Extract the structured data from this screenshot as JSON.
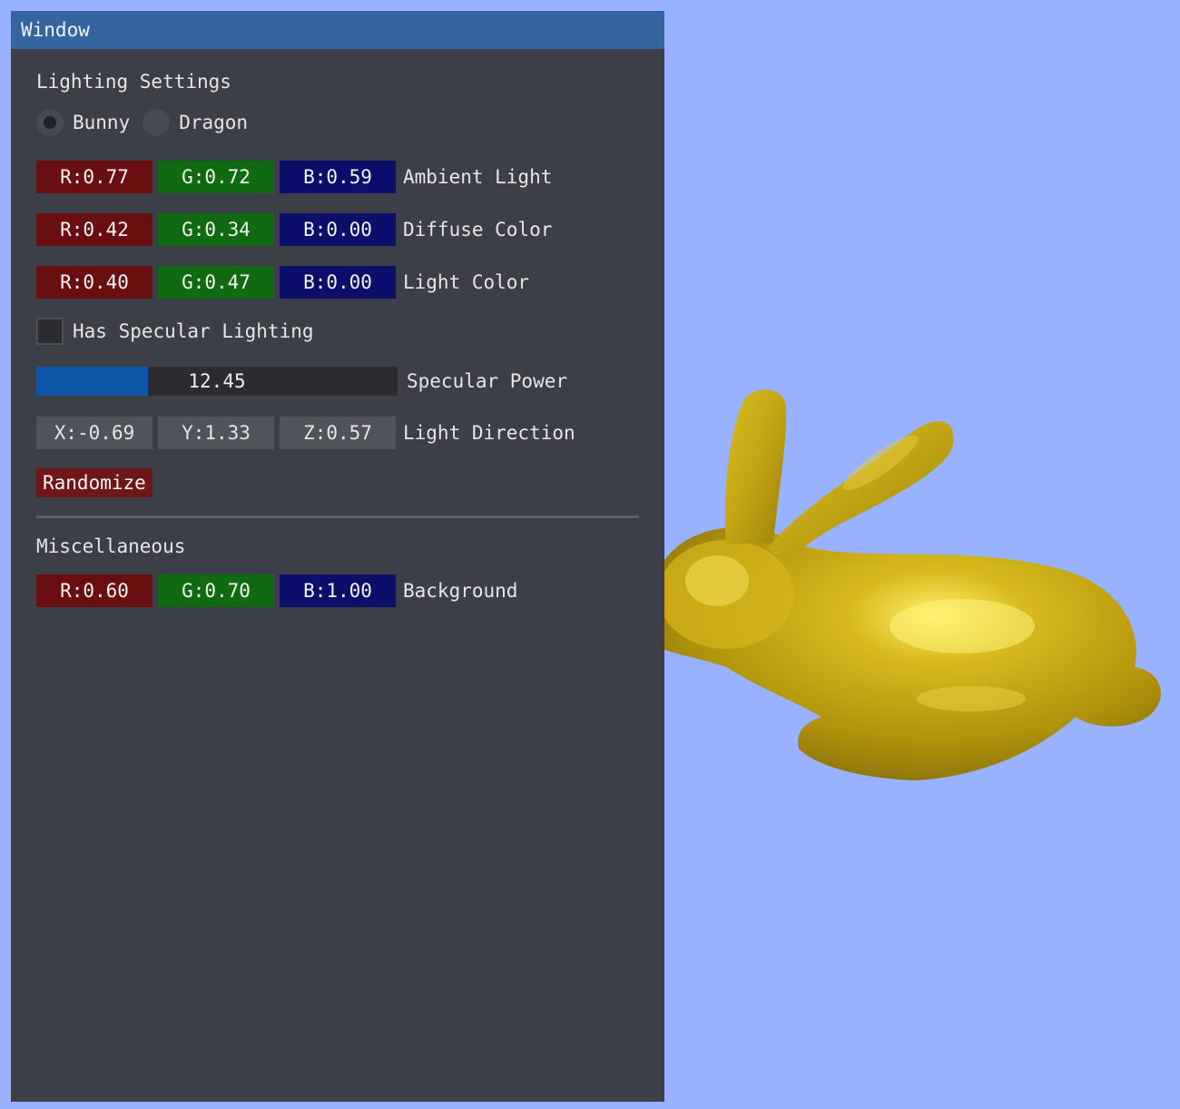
{
  "window": {
    "title": "Window"
  },
  "lighting": {
    "section_title": "Lighting Settings",
    "models": [
      {
        "label": "Bunny",
        "selected": true
      },
      {
        "label": "Dragon",
        "selected": false
      }
    ],
    "ambient": {
      "r": "R:0.77",
      "g": "G:0.72",
      "b": "B:0.59",
      "label": "Ambient Light"
    },
    "diffuse": {
      "r": "R:0.42",
      "g": "G:0.34",
      "b": "B:0.00",
      "label": "Diffuse Color"
    },
    "light_color": {
      "r": "R:0.40",
      "g": "G:0.47",
      "b": "B:0.00",
      "label": "Light Color"
    },
    "specular_checkbox": {
      "label": "Has Specular Lighting",
      "checked": false
    },
    "specular_power": {
      "value": "12.45",
      "fill_fraction": 0.31,
      "label": "Specular Power"
    },
    "light_direction": {
      "x": "X:-0.69",
      "y": "Y:1.33",
      "z": "Z:0.57",
      "label": "Light Direction"
    },
    "randomize_label": "Randomize"
  },
  "misc": {
    "section_title": "Miscellaneous",
    "background": {
      "r": "R:0.60",
      "g": "G:0.70",
      "b": "B:1.00",
      "label": "Background"
    }
  },
  "colors": {
    "viewport_background": "#99b2ff",
    "window_background": "#3c3f47",
    "titlebar": "#3565a0",
    "bunny_gold": "#b89a10"
  }
}
